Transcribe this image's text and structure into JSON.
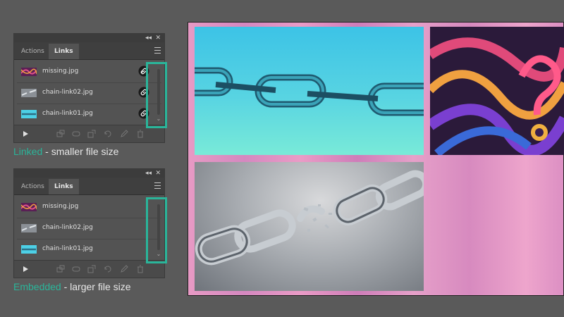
{
  "panels": [
    {
      "tabs": {
        "actions": "Actions",
        "links": "Links"
      },
      "controls": {
        "collapse": "◂◂",
        "close": "✕"
      },
      "items": [
        {
          "name": "missing.jpg",
          "thumb": "abstract-thumb",
          "status_icon": "link-icon"
        },
        {
          "name": "chain-link02.jpg",
          "thumb": "broken-chain-thumb",
          "status_icon": "link-icon"
        },
        {
          "name": "chain-link01.jpg",
          "thumb": "blue-chain-thumb",
          "status_icon": "link-icon"
        }
      ],
      "caption": {
        "accent": "Linked",
        "rest": " - smaller file size"
      }
    },
    {
      "tabs": {
        "actions": "Actions",
        "links": "Links"
      },
      "controls": {
        "collapse": "◂◂",
        "close": "✕"
      },
      "items": [
        {
          "name": "missing.jpg",
          "thumb": "abstract-thumb",
          "status_icon": ""
        },
        {
          "name": "chain-link02.jpg",
          "thumb": "broken-chain-thumb",
          "status_icon": ""
        },
        {
          "name": "chain-link01.jpg",
          "thumb": "blue-chain-thumb",
          "status_icon": ""
        }
      ],
      "caption": {
        "accent": "Embedded",
        "rest": " - larger file size"
      }
    }
  ],
  "canvas": {
    "images": [
      "chain-link01.jpg",
      "missing.jpg",
      "chain-link02.jpg"
    ]
  },
  "colors": {
    "accent": "#2ab59a",
    "workspace": "#5a5a5a",
    "panel": "#535353"
  }
}
